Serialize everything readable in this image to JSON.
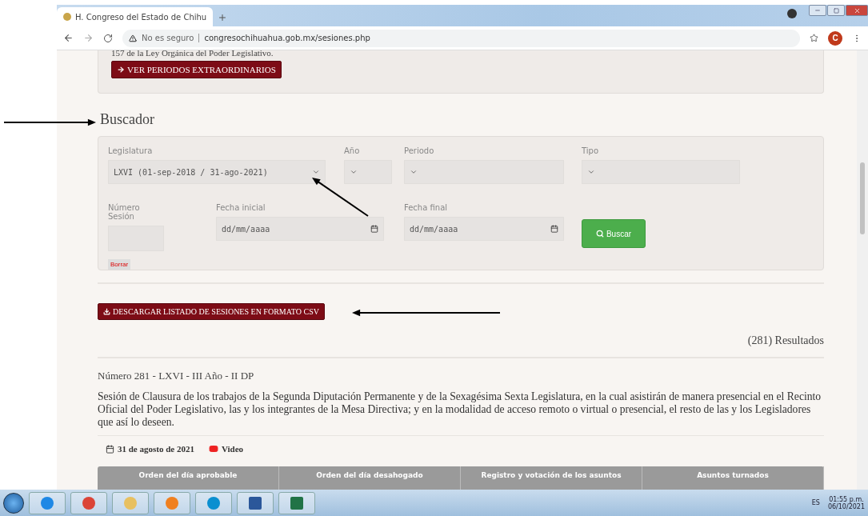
{
  "browser": {
    "tab_title": "H. Congreso del Estado de Chihu",
    "security": "No es seguro",
    "url": "congresochihuahua.gob.mx/sesiones.php",
    "profile": "C"
  },
  "intro": {
    "text": "157 de la Ley Orgánica del Poder Legislativo.",
    "button": "VER PERIODOS EXTRAORDINARIOS"
  },
  "search": {
    "title": "Buscador",
    "row1": [
      {
        "kind": "select",
        "label": "Legislatura",
        "value": "LXVI (01-sep-2018 / 31-ago-2021)"
      },
      {
        "kind": "select",
        "label": "Año"
      },
      {
        "kind": "select",
        "label": "Periodo"
      },
      {
        "kind": "select",
        "label": "Tipo"
      }
    ],
    "row2": [
      {
        "kind": "text",
        "label": "Número Sesión",
        "clear": "Borrar"
      },
      {
        "kind": "date",
        "label": "Fecha inicial",
        "placeholder": "dd/mm/aaaa"
      },
      {
        "kind": "date",
        "label": "Fecha final",
        "placeholder": "dd/mm/aaaa"
      }
    ],
    "button": "Buscar"
  },
  "csv_button": "DESCARGAR LISTADO DE SESIONES EN FORMATO CSV",
  "results": "(281) Resultados",
  "session": {
    "heading": "Número 281 - LXVI - III Año - II DP",
    "description": "Sesión de Clausura de los trabajos de la Segunda Diputación Permanente y de la Sexagésima Sexta Legislatura, en la cual asistirán de manera presencial en el Recinto Oficial del Poder Legislativo, las y los integrantes de la Mesa Directiva; y en la modalidad de acceso remoto o virtual o presencial, el resto de las y los Legisladores que así lo deseen.",
    "date": "31 de agosto de 2021",
    "video": "Video"
  },
  "table": {
    "columns": [
      "Orden del día aprobable",
      "Orden del día desahogado",
      "Registro y votación de los asuntos",
      "Asuntos turnados"
    ]
  },
  "taskbar": {
    "language": "ES",
    "time": "01:55 p.m.",
    "date": "06/10/2021"
  }
}
